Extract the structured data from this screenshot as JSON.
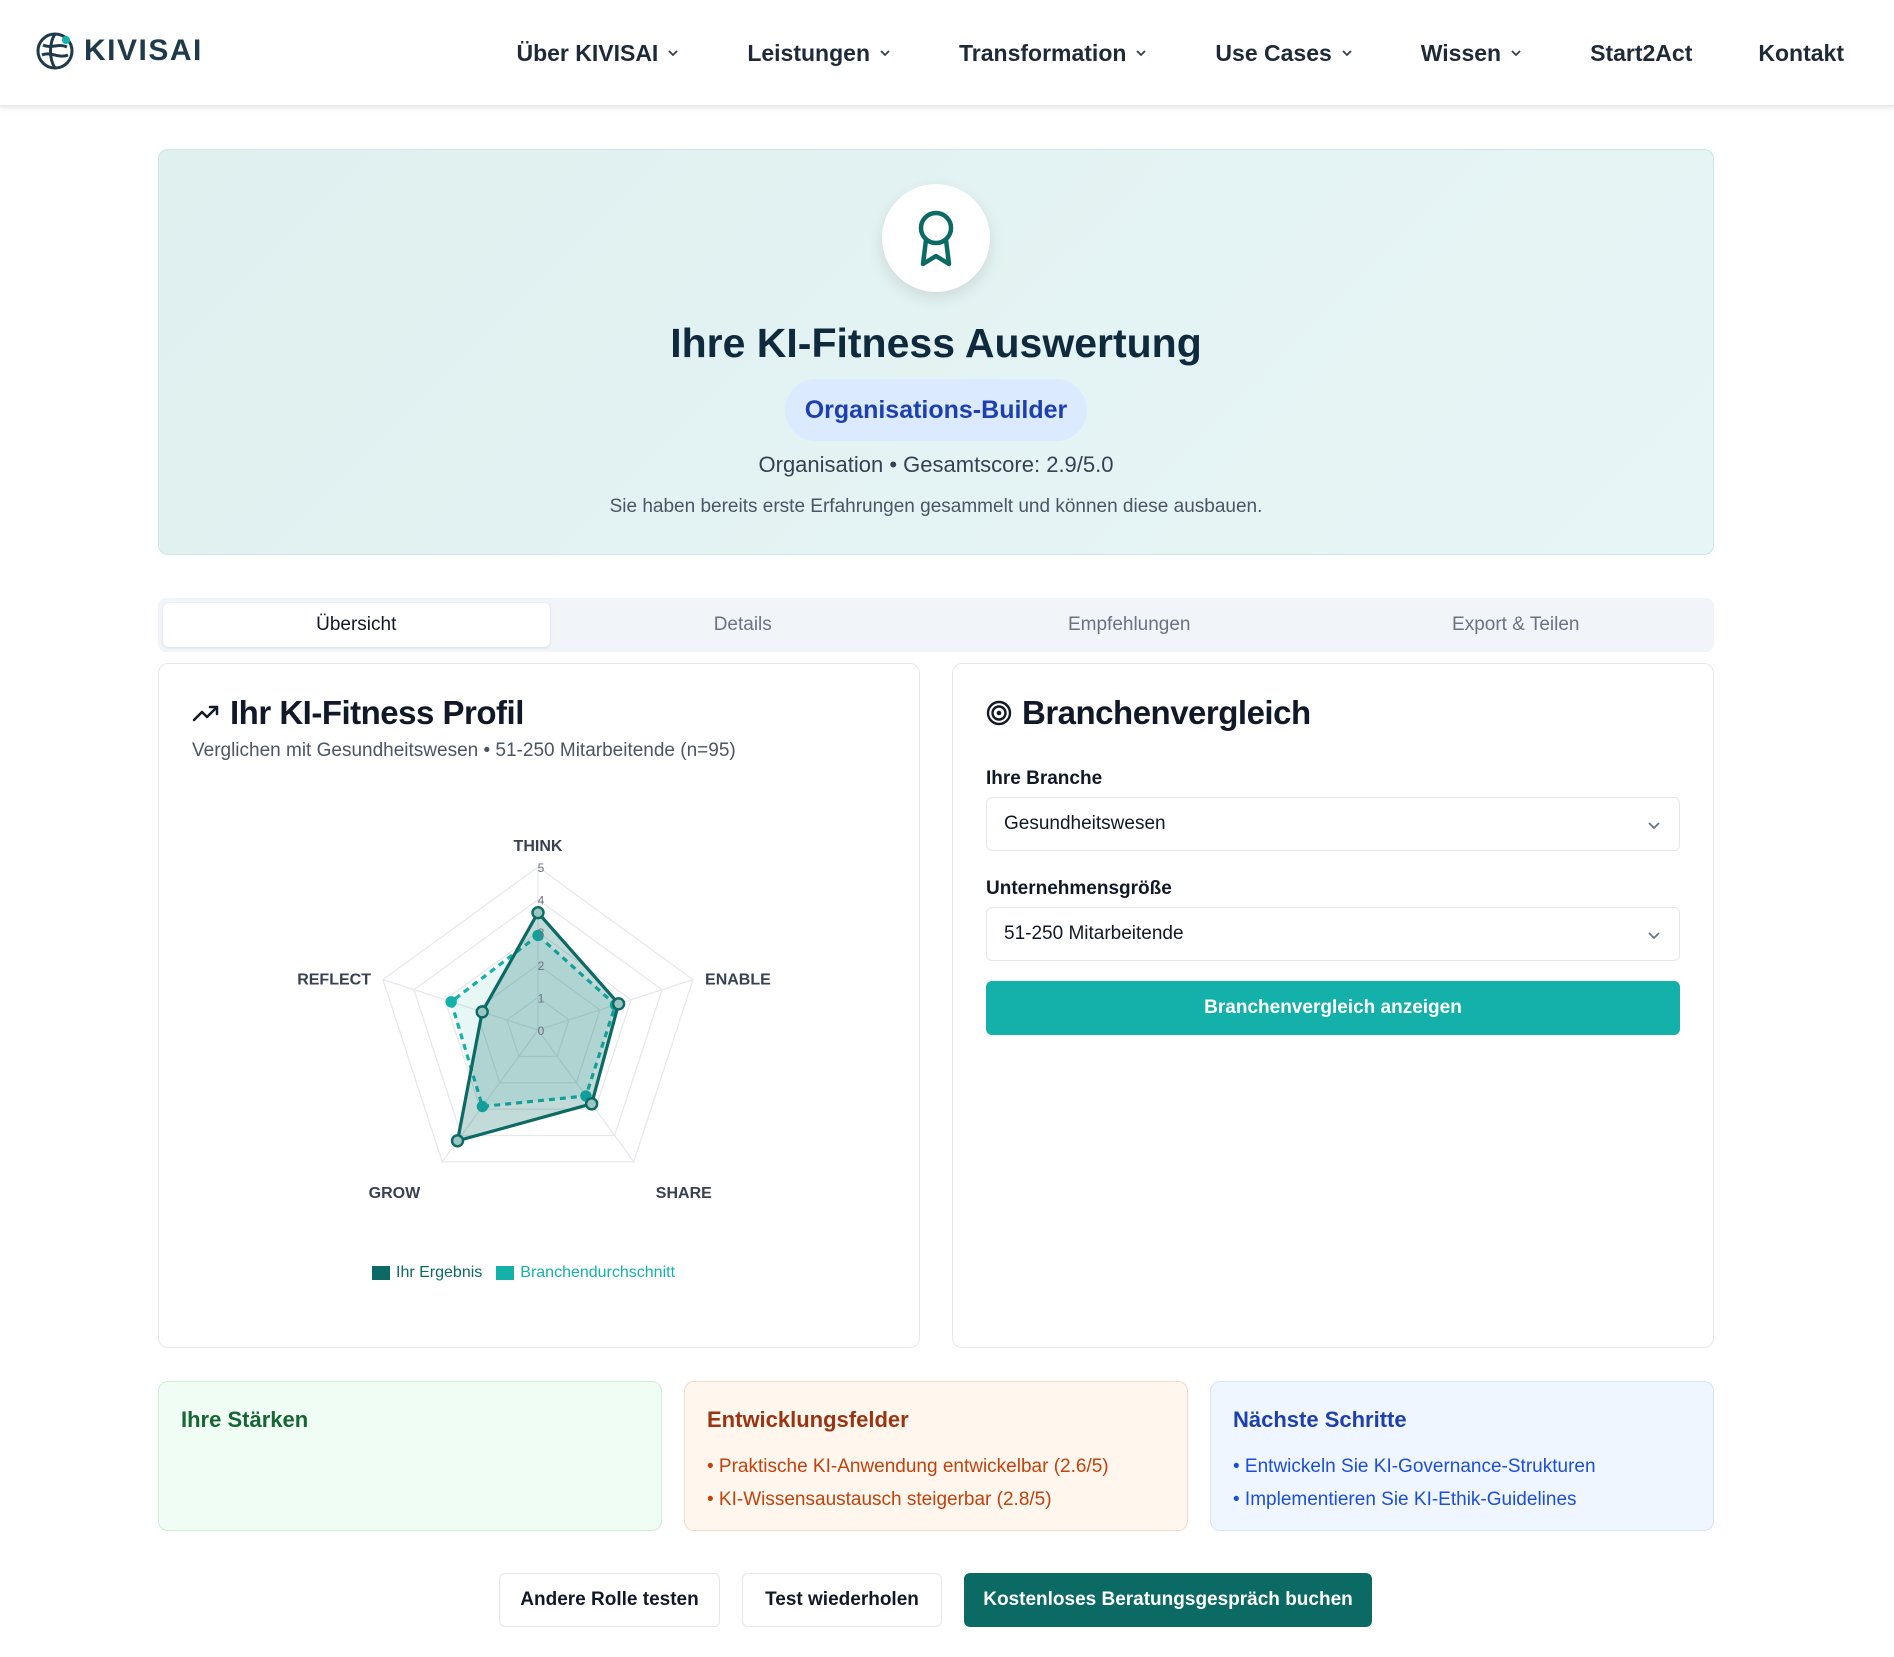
{
  "header": {
    "logo_text": "KIVISAI",
    "nav": [
      {
        "label": "Über KIVISAI",
        "dropdown": true
      },
      {
        "label": "Leistungen",
        "dropdown": true
      },
      {
        "label": "Transformation",
        "dropdown": true
      },
      {
        "label": "Use Cases",
        "dropdown": true
      },
      {
        "label": "Wissen",
        "dropdown": true
      },
      {
        "label": "Start2Act",
        "dropdown": false
      },
      {
        "label": "Kontakt",
        "dropdown": false
      }
    ]
  },
  "hero": {
    "icon": "award-icon",
    "title": "Ihre KI-Fitness Auswertung",
    "badge": "Organisations-Builder",
    "score_line": "Organisation • Gesamtscore: 2.9/5.0",
    "description": "Sie haben bereits erste Erfahrungen gesammelt und können diese ausbauen."
  },
  "tabs": [
    {
      "label": "Übersicht",
      "active": true
    },
    {
      "label": "Details",
      "active": false
    },
    {
      "label": "Empfehlungen",
      "active": false
    },
    {
      "label": "Export & Teilen",
      "active": false
    }
  ],
  "profile": {
    "title": "Ihr KI-Fitness Profil",
    "subtitle": "Verglichen mit Gesundheitswesen • 51-250 Mitarbeitende (n=95)"
  },
  "comparison": {
    "title": "Branchenvergleich",
    "branch_label": "Ihre Branche",
    "branch_value": "Gesundheitswesen",
    "size_label": "Unternehmensgröße",
    "size_value": "51-250 Mitarbeitende",
    "button_label": "Branchenvergleich anzeigen"
  },
  "chart_data": {
    "type": "radar",
    "axes": [
      "THINK",
      "ENABLE",
      "SHARE",
      "GROW",
      "REFLECT"
    ],
    "scale_ticks": [
      "0",
      "1",
      "2",
      "3",
      "4",
      "5"
    ],
    "range": [
      0,
      5
    ],
    "series": [
      {
        "name": "Ihr Ergebnis",
        "values": [
          3.6,
          2.6,
          2.8,
          4.2,
          1.8
        ],
        "color": "#0b6b64"
      },
      {
        "name": "Branchendurchschnitt",
        "values": [
          2.9,
          2.5,
          2.5,
          2.9,
          2.8
        ],
        "color": "#14b1ab"
      }
    ]
  },
  "strengths": {
    "title": "Ihre Stärken",
    "items": []
  },
  "development": {
    "title": "Entwicklungsfelder",
    "items": [
      "• Praktische KI-Anwendung entwickelbar (2.6/5)",
      "• KI-Wissensaustausch steigerbar (2.8/5)"
    ]
  },
  "next_steps": {
    "title": "Nächste Schritte",
    "items": [
      "• Entwickeln Sie KI-Governance-Strukturen",
      "• Implementieren Sie KI-Ethik-Guidelines"
    ]
  },
  "actions": {
    "other_role": "Andere Rolle testen",
    "repeat": "Test wiederholen",
    "book": "Kostenloses Beratungsgespräch buchen"
  }
}
